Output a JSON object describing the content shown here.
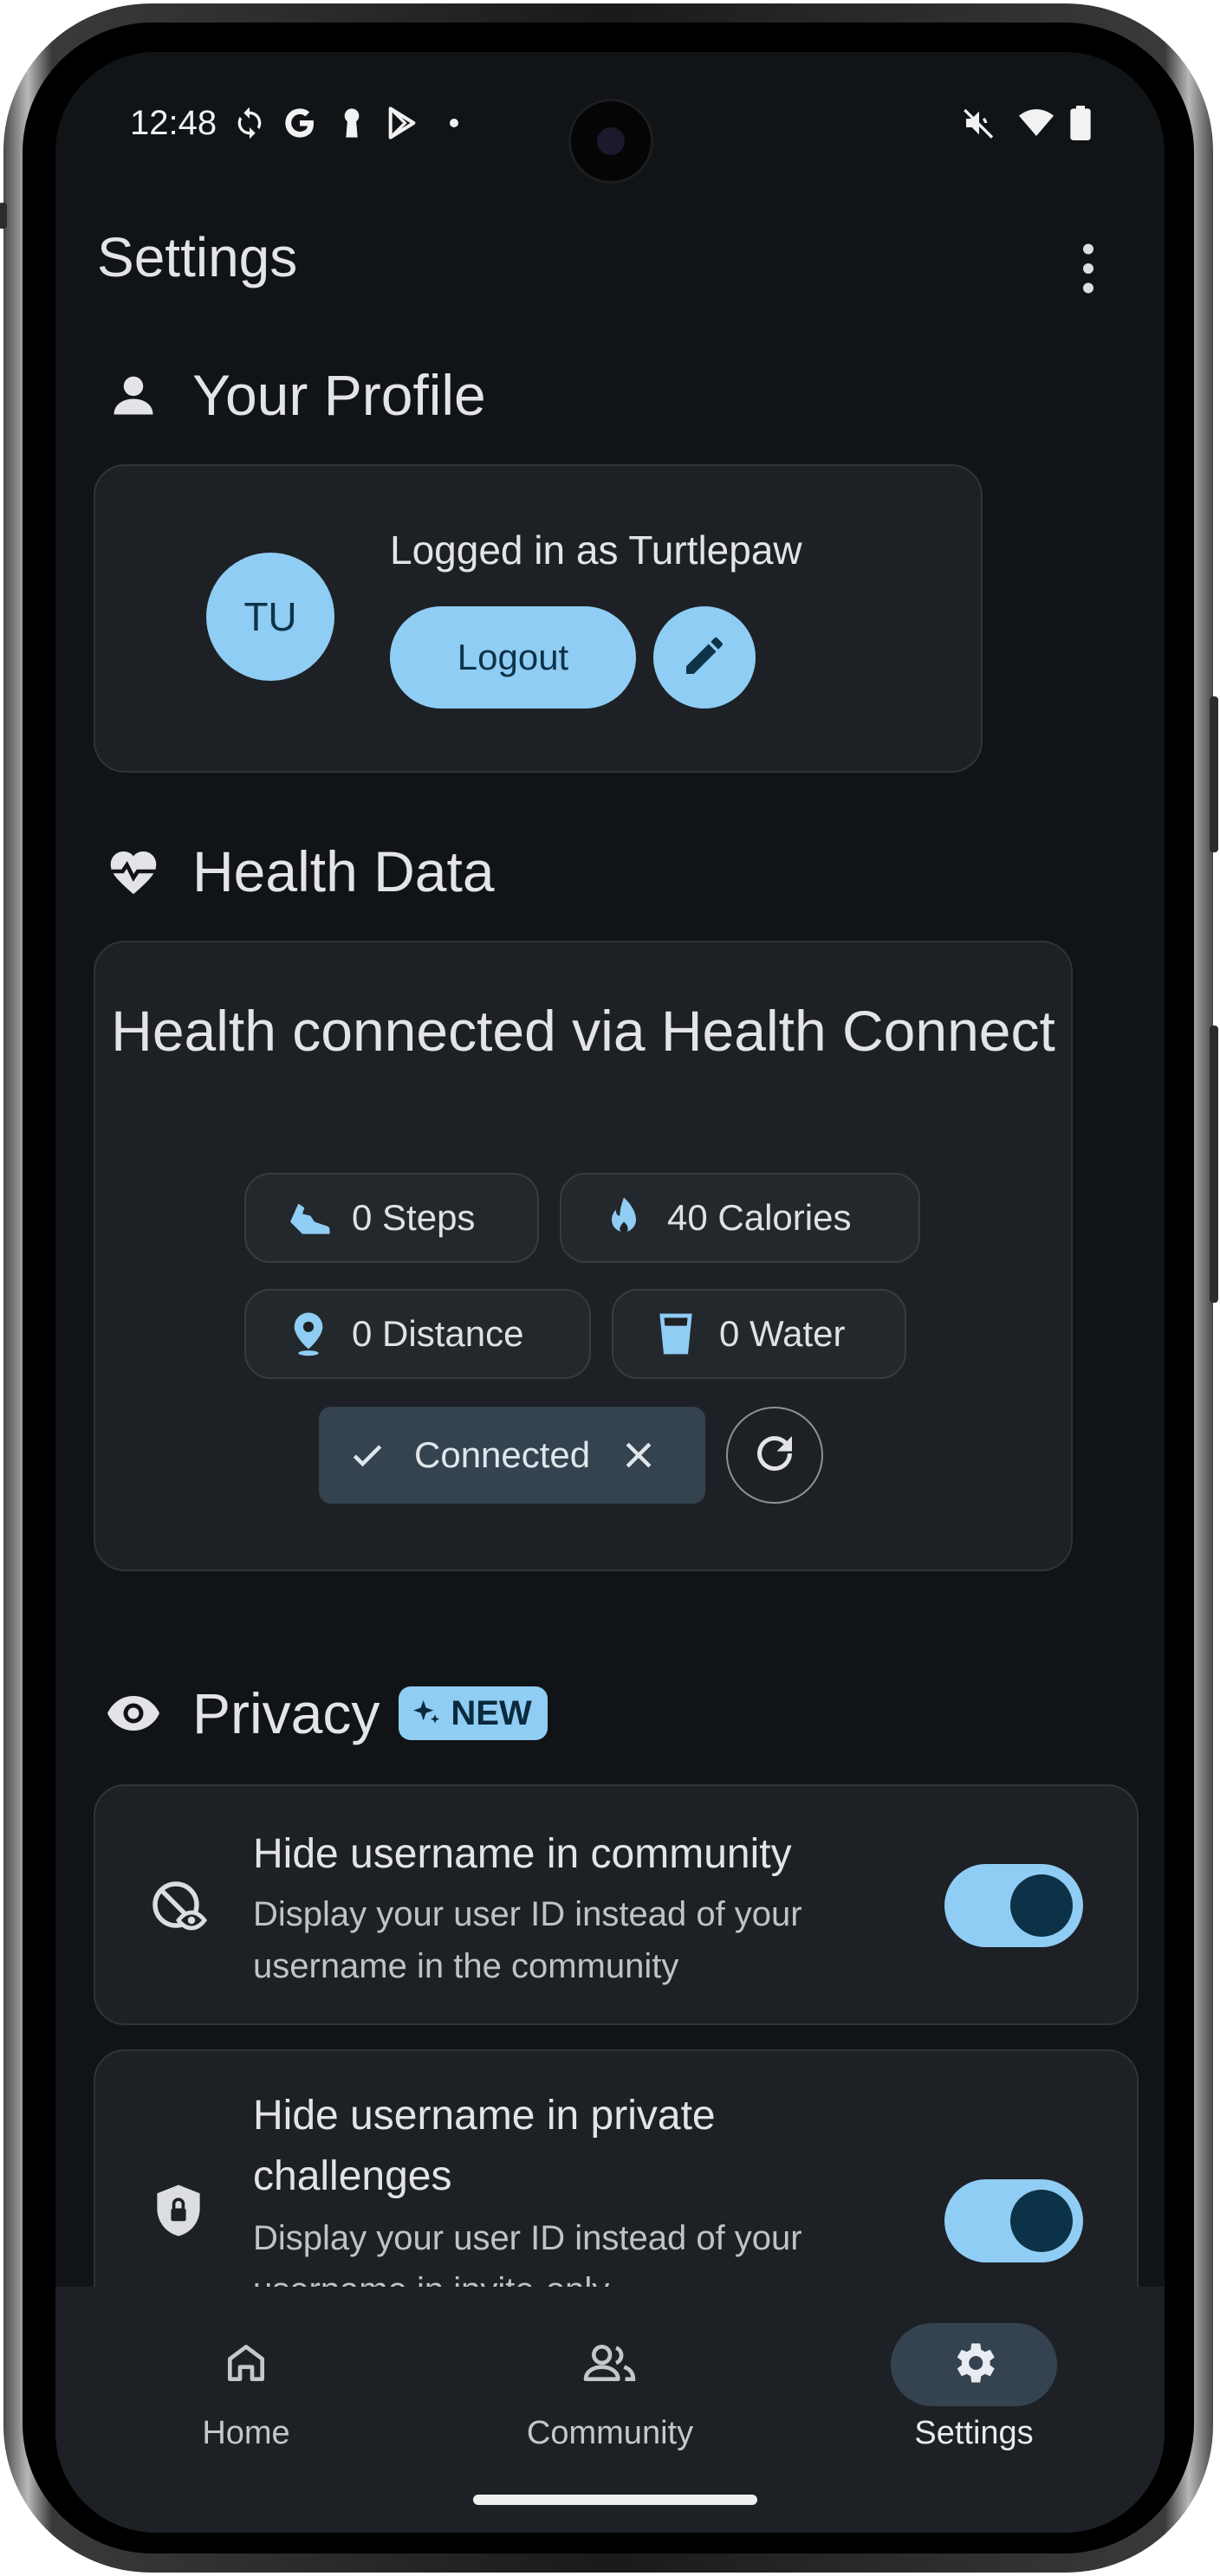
{
  "status_bar": {
    "time": "12:48",
    "left_icons": [
      "sync-icon",
      "google-icon",
      "keyhole-icon",
      "play-store-icon",
      "notification-dot-icon"
    ],
    "right_icons": [
      "mute-icon",
      "wifi-icon",
      "battery-icon"
    ]
  },
  "app_bar": {
    "title": "Settings",
    "menu_icon": "more-vert-icon"
  },
  "profile": {
    "section_title": "Your Profile",
    "avatar_initials": "TU",
    "logged_in_text": "Logged in as Turtlepaw",
    "logout_label": "Logout"
  },
  "health": {
    "section_title": "Health Data",
    "title": "Health connected via Health Connect",
    "chips": {
      "steps": "0 Steps",
      "calories": "40 Calories",
      "distance": "0 Distance",
      "water": "0 Water"
    },
    "status_label": "Connected"
  },
  "privacy": {
    "section_title": "Privacy",
    "badge": "NEW",
    "settings": [
      {
        "title": "Hide username in community",
        "description": "Display your user ID instead of your username in the community",
        "enabled": true
      },
      {
        "title": "Hide username in private challenges",
        "description": "Display your user ID instead of your username in invite-only",
        "enabled": true
      }
    ]
  },
  "nav": {
    "items": [
      {
        "label": "Home",
        "icon": "home-icon",
        "selected": false
      },
      {
        "label": "Community",
        "icon": "community-icon",
        "selected": false
      },
      {
        "label": "Settings",
        "icon": "settings-icon",
        "selected": true
      }
    ]
  },
  "colors": {
    "background": "#111417",
    "card": "#1d2125",
    "accent": "#90cdf4",
    "accent_dark": "#0b3246",
    "selected_pill": "#34434f"
  }
}
